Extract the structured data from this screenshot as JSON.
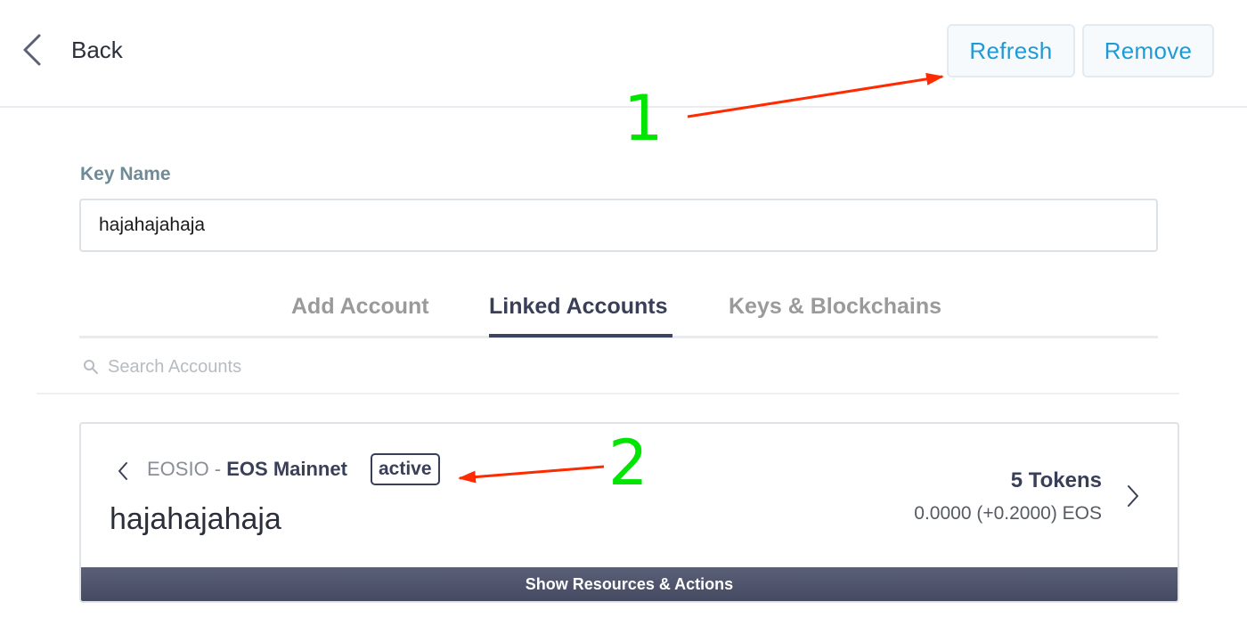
{
  "header": {
    "back_label": "Back",
    "refresh_label": "Refresh",
    "remove_label": "Remove"
  },
  "key": {
    "label": "Key Name",
    "value": "hajahajahaja"
  },
  "tabs": [
    {
      "label": "Add Account",
      "active": false
    },
    {
      "label": "Linked Accounts",
      "active": true
    },
    {
      "label": "Keys & Blockchains",
      "active": false
    }
  ],
  "search": {
    "placeholder": "Search Accounts",
    "icon": "search-icon"
  },
  "account": {
    "chain_prefix": "EOSIO",
    "chain_separator": " - ",
    "network": "EOS Mainnet",
    "permission": "active",
    "name": "hajahajahaja",
    "tokens": "5 Tokens",
    "balance": "0.0000 (+0.2000) EOS",
    "action_bar": "Show Resources & Actions"
  },
  "annotations": [
    {
      "number": "1"
    },
    {
      "number": "2"
    }
  ],
  "colors": {
    "accent": "#1e9bd7",
    "label": "#6e8b97",
    "dark": "#3a3f58",
    "annotation_number": "#00e600",
    "annotation_arrow": "#ff2a00",
    "action_bar": "#4f556c"
  }
}
